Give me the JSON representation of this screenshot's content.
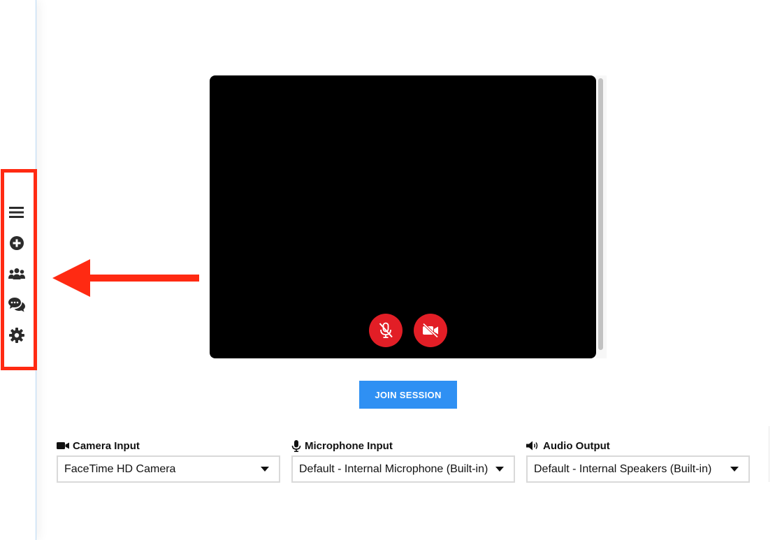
{
  "sidebar": {
    "items": [
      {
        "name": "menu-icon"
      },
      {
        "name": "add-icon"
      },
      {
        "name": "people-icon"
      },
      {
        "name": "chat-icon"
      },
      {
        "name": "settings-icon"
      }
    ]
  },
  "annotation": {
    "color": "#ff2a12"
  },
  "video": {
    "background": "#000000",
    "mic_button_icon": "microphone-muted-icon",
    "camera_button_icon": "camera-off-icon",
    "button_color": "#e21e26"
  },
  "join": {
    "label": "JOIN SESSION",
    "color": "#2f90f3"
  },
  "devices": {
    "camera": {
      "label": "Camera Input",
      "value": "FaceTime HD Camera",
      "icon": "video-camera-icon"
    },
    "microphone": {
      "label": "Microphone Input",
      "value": "Default - Internal Microphone (Built-in)",
      "icon": "microphone-icon"
    },
    "audio": {
      "label": "Audio Output",
      "value": "Default - Internal Speakers (Built-in)",
      "icon": "speaker-icon"
    }
  }
}
